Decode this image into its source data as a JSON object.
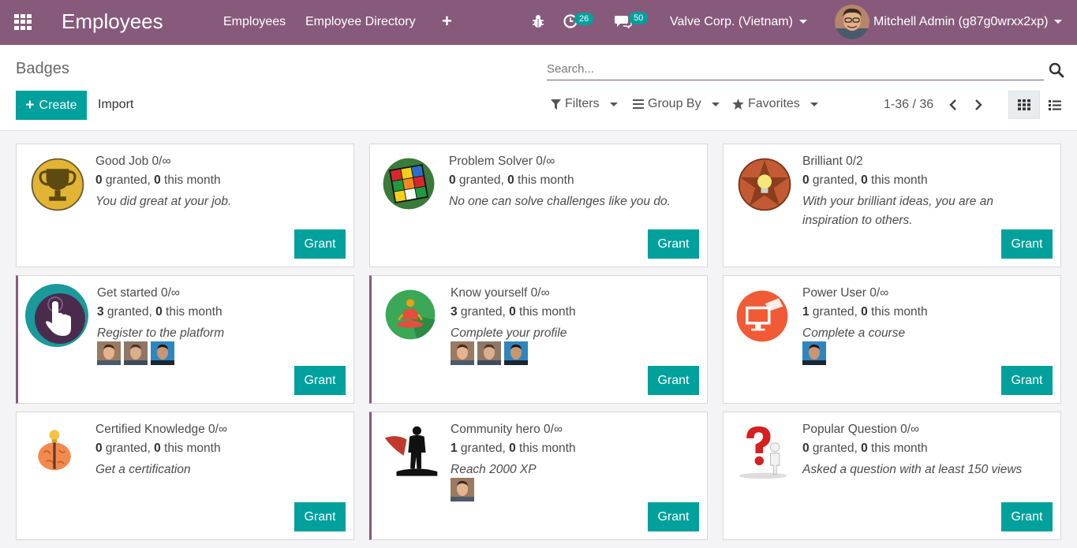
{
  "navbar": {
    "app_title": "Employees",
    "menu": [
      "Employees",
      "Employee Directory"
    ],
    "plus": "+",
    "activity_count": "26",
    "message_count": "50",
    "company": "Valve Corp. (Vietnam)",
    "user": "Mitchell Admin (g87g0wrxx2xp)",
    "color": "#875a7b"
  },
  "control": {
    "breadcrumb": "Badges",
    "search_placeholder": "Search...",
    "create_label": "Create",
    "import_label": "Import",
    "filters_label": "Filters",
    "groupby_label": "Group By",
    "favorites_label": "Favorites",
    "pager": "1-36 / 36",
    "accent": "#00a09d"
  },
  "cards": [
    {
      "title": "Good Job 0/∞",
      "granted": "0",
      "granted_text": " granted, ",
      "month": "0",
      "month_text": " this month",
      "desc": "You did great at your job.",
      "icon": "trophy-icon",
      "avatars": 0
    },
    {
      "title": "Problem Solver 0/∞",
      "granted": "0",
      "granted_text": " granted, ",
      "month": "0",
      "month_text": " this month",
      "desc": "No one can solve challenges like you do.",
      "icon": "rubiks-cube-icon",
      "avatars": 0
    },
    {
      "title": "Brilliant 0/2",
      "granted": "0",
      "granted_text": " granted, ",
      "month": "0",
      "month_text": " this month",
      "desc": "With your brilliant ideas, you are an inspiration to others.",
      "icon": "lightbulb-star-icon",
      "avatars": 0
    },
    {
      "title": "Get started 0/∞",
      "granted": "3",
      "granted_text": " granted, ",
      "month": "0",
      "month_text": " this month",
      "desc": "Register to the platform",
      "icon": "hand-click-icon",
      "avatars": 3
    },
    {
      "title": "Know yourself 0/∞",
      "granted": "3",
      "granted_text": " granted, ",
      "month": "0",
      "month_text": " this month",
      "desc": "Complete your profile",
      "icon": "meditation-icon",
      "avatars": 3
    },
    {
      "title": "Power User 0/∞",
      "granted": "1",
      "granted_text": " granted, ",
      "month": "0",
      "month_text": " this month",
      "desc": "Complete a course",
      "icon": "graduation-screen-icon",
      "avatars": 1
    },
    {
      "title": "Certified Knowledge 0/∞",
      "granted": "0",
      "granted_text": " granted, ",
      "month": "0",
      "month_text": " this month",
      "desc": "Get a certification",
      "icon": "brain-bulb-icon",
      "avatars": 0
    },
    {
      "title": "Community hero 0/∞",
      "granted": "1",
      "granted_text": " granted, ",
      "month": "0",
      "month_text": " this month",
      "desc": "Reach 2000 XP",
      "icon": "hero-silhouette-icon",
      "avatars": 1
    },
    {
      "title": "Popular Question 0/∞",
      "granted": "0",
      "granted_text": " granted, ",
      "month": "0",
      "month_text": " this month",
      "desc": "Asked a question with at least 150 views",
      "icon": "question-figure-icon",
      "avatars": 0
    }
  ],
  "grant_label": "Grant"
}
